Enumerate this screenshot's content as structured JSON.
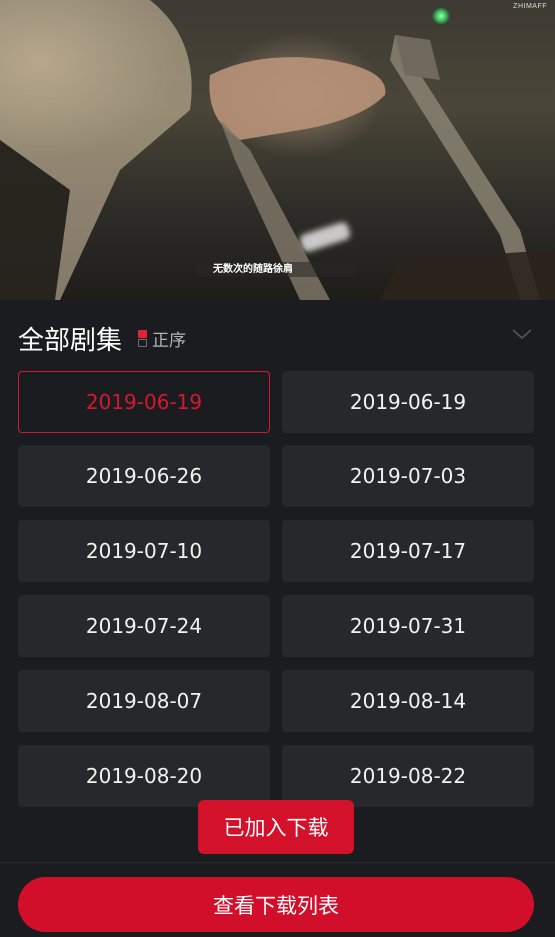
{
  "video": {
    "subtitle": "无数次的随路徐肩",
    "watermark": "ZHIMAFF"
  },
  "header": {
    "title": "全部剧集",
    "sort_label": "正序"
  },
  "episodes": [
    {
      "label": "2019-06-19",
      "selected": true
    },
    {
      "label": "2019-06-19",
      "selected": false
    },
    {
      "label": "2019-06-26",
      "selected": false
    },
    {
      "label": "2019-07-03",
      "selected": false
    },
    {
      "label": "2019-07-10",
      "selected": false
    },
    {
      "label": "2019-07-17",
      "selected": false
    },
    {
      "label": "2019-07-24",
      "selected": false
    },
    {
      "label": "2019-07-31",
      "selected": false
    },
    {
      "label": "2019-08-07",
      "selected": false
    },
    {
      "label": "2019-08-14",
      "selected": false
    },
    {
      "label": "2019-08-20",
      "selected": false
    },
    {
      "label": "2019-08-22",
      "selected": false
    }
  ],
  "toast": "已加入下载",
  "footer": {
    "button_label": "查看下载列表"
  },
  "colors": {
    "accent": "#d20f2a",
    "background": "#1b1c1f",
    "cell": "#27282c"
  },
  "icons": {
    "sort": "sort-order-icon",
    "collapse": "chevron-down-icon"
  }
}
